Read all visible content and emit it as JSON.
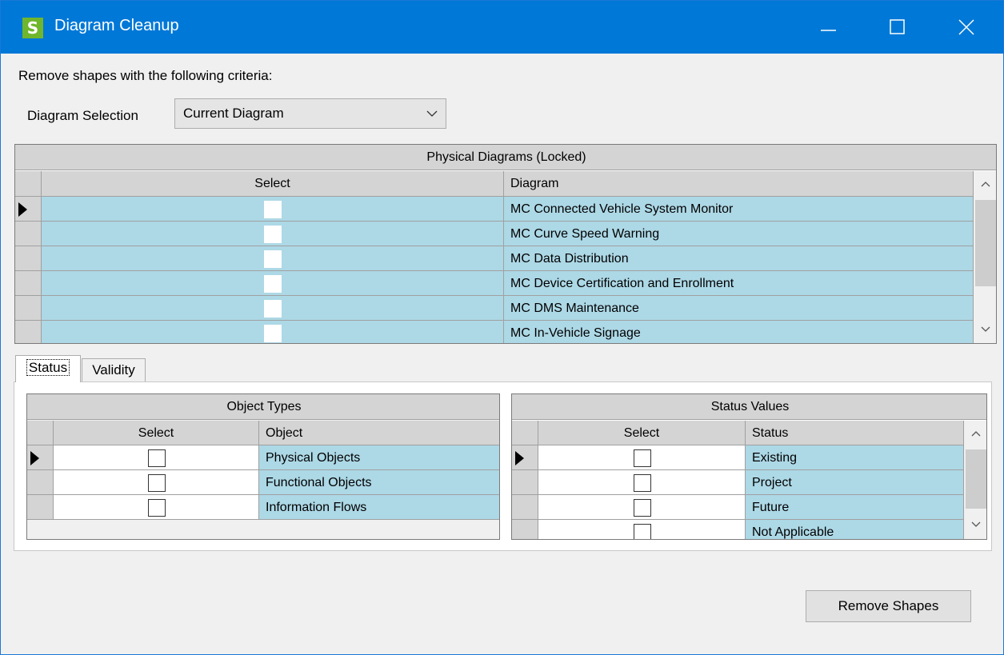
{
  "window": {
    "title": "Diagram Cleanup",
    "app_icon_letter": "S",
    "accent_color": "#0078d7"
  },
  "criteria_label": "Remove shapes with the following criteria:",
  "diagram_selection": {
    "label": "Diagram Selection",
    "value": "Current Diagram"
  },
  "physical_grid": {
    "title": "Physical Diagrams (Locked)",
    "columns": [
      "Select",
      "Diagram"
    ],
    "rows": [
      {
        "diagram": "MC Connected Vehicle System Monitor",
        "checked": false
      },
      {
        "diagram": "MC Curve Speed Warning",
        "checked": false
      },
      {
        "diagram": "MC Data Distribution",
        "checked": false
      },
      {
        "diagram": "MC Device Certification and Enrollment",
        "checked": false
      },
      {
        "diagram": "MC DMS Maintenance",
        "checked": false
      },
      {
        "diagram": "MC In-Vehicle Signage",
        "checked": false
      }
    ]
  },
  "tabs": [
    {
      "label": "Status",
      "active": true
    },
    {
      "label": "Validity",
      "active": false
    }
  ],
  "object_types_grid": {
    "title": "Object Types",
    "columns": [
      "Select",
      "Object"
    ],
    "rows": [
      {
        "object": "Physical Objects",
        "checked": false
      },
      {
        "object": "Functional Objects",
        "checked": false
      },
      {
        "object": "Information Flows",
        "checked": false
      }
    ]
  },
  "status_values_grid": {
    "title": "Status Values",
    "columns": [
      "Select",
      "Status"
    ],
    "rows": [
      {
        "status": "Existing",
        "checked": false
      },
      {
        "status": "Project",
        "checked": false
      },
      {
        "status": "Future",
        "checked": false
      },
      {
        "status": "Not Applicable",
        "checked": false
      }
    ]
  },
  "remove_button_label": "Remove Shapes"
}
